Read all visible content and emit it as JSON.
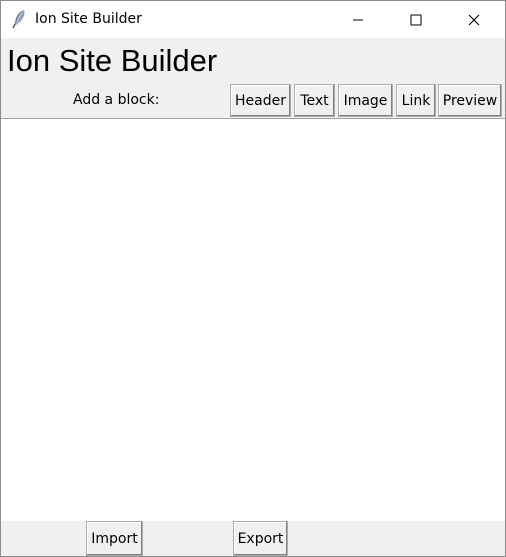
{
  "window": {
    "title": "Ion Site Builder"
  },
  "header": {
    "heading": "Ion Site Builder"
  },
  "toolbar": {
    "label": "Add a block:",
    "buttons": [
      "Header",
      "Text",
      "Image",
      "Link",
      "Preview"
    ]
  },
  "footer": {
    "import_label": "Import",
    "export_label": "Export"
  },
  "icons": {
    "app": "feather-icon",
    "minimize": "minimize-icon",
    "maximize": "maximize-icon",
    "close": "close-icon"
  },
  "colors": {
    "background": "#f0f0f0",
    "canvas": "#ffffff",
    "button_border": "#adadad"
  }
}
